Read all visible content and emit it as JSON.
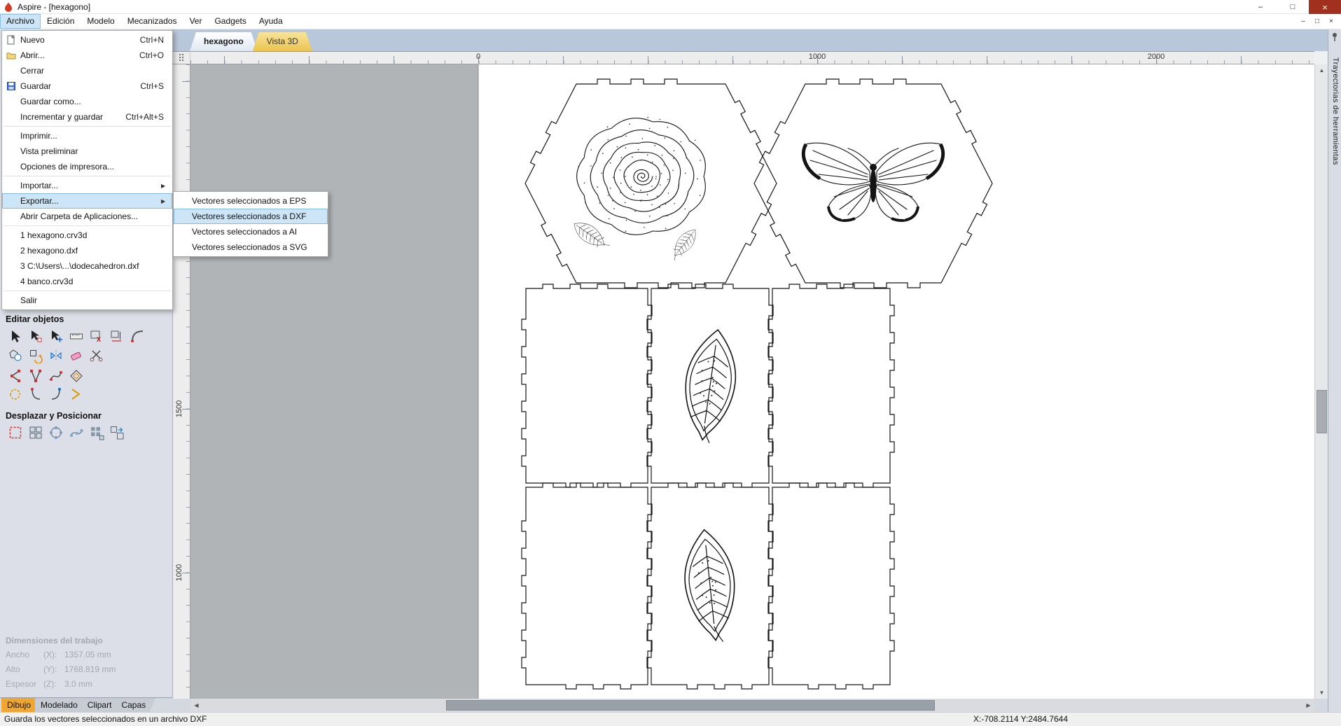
{
  "window": {
    "title": "Aspire - [hexagono]"
  },
  "icons": {
    "minimize": "–",
    "maximize": "□",
    "close": "×",
    "child_minimize": "–",
    "child_restore": "□",
    "child_close": "×",
    "submenu_arrow": "▶",
    "scroll_up": "▲",
    "scroll_down": "▼",
    "scroll_left": "◀",
    "scroll_right": "▶"
  },
  "menubar": {
    "items": [
      "Archivo",
      "Edición",
      "Modelo",
      "Mecanizados",
      "Ver",
      "Gadgets",
      "Ayuda"
    ],
    "active": "Archivo"
  },
  "file_menu": {
    "items": [
      {
        "label": "Nuevo",
        "shortcut": "Ctrl+N"
      },
      {
        "label": "Abrir...",
        "shortcut": "Ctrl+O"
      },
      {
        "label": "Cerrar",
        "shortcut": ""
      },
      {
        "label": "Guardar",
        "shortcut": "Ctrl+S"
      },
      {
        "label": "Guardar como...",
        "shortcut": ""
      },
      {
        "label": "Incrementar y guardar",
        "shortcut": "Ctrl+Alt+S"
      },
      {
        "label": "Imprimir...",
        "shortcut": ""
      },
      {
        "label": "Vista preliminar",
        "shortcut": ""
      },
      {
        "label": "Opciones de impresora...",
        "shortcut": ""
      },
      {
        "label": "Importar...",
        "shortcut": ""
      },
      {
        "label": "Exportar...",
        "shortcut": ""
      },
      {
        "label": "Abrir Carpeta de Aplicaciones...",
        "shortcut": ""
      },
      {
        "label": "1 hexagono.crv3d",
        "shortcut": ""
      },
      {
        "label": "2 hexagono.dxf",
        "shortcut": ""
      },
      {
        "label": "3 C:\\Users\\...\\dodecahedron.dxf",
        "shortcut": ""
      },
      {
        "label": "4 banco.crv3d",
        "shortcut": ""
      },
      {
        "label": "Salir",
        "shortcut": ""
      }
    ]
  },
  "export_submenu": {
    "items": [
      "Vectores seleccionados a EPS",
      "Vectores seleccionados a DXF",
      "Vectores seleccionados a AI",
      "Vectores seleccionados a SVG"
    ],
    "highlighted": "Vectores seleccionados a DXF"
  },
  "view_tabs": {
    "tab1": "hexagono",
    "tab2": "Vista 3D"
  },
  "rulers": {
    "h_labels": [
      "0",
      "1000",
      "2000"
    ],
    "v_labels": [
      "1500",
      "1000"
    ]
  },
  "left_panel": {
    "edit_section_title": "Editar objetos",
    "move_section_title": "Desplazar y Posicionar",
    "edit_tool_rows": [
      [
        "select-tool",
        "node-edit-tool",
        "move-tool",
        "measure-tool",
        "dim-x-tool",
        "dim-xy-tool",
        "fillet-tool"
      ],
      [
        "shapes-tool",
        "group-tool",
        "mirror-tool",
        "erase-tool",
        "scissors-tool"
      ],
      [
        "arc-tool",
        "polyline-tool",
        "curve-tool",
        "offset-tool"
      ],
      [
        "lasso-tool",
        "join-open-tool",
        "join-close-tool",
        "extend-tool"
      ]
    ],
    "move_tools": [
      "align-sel-tool",
      "align-grid-tool",
      "align-circle-tool",
      "path-array-tool",
      "block-array-tool",
      "nest-tool"
    ],
    "dimensions": {
      "title": "Dimensiones del trabajo",
      "rows": [
        {
          "label": "Ancho",
          "axis": "(X):",
          "value": "1357.05 mm"
        },
        {
          "label": "Alto",
          "axis": "(Y):",
          "value": "1768.819 mm"
        },
        {
          "label": "Espesor",
          "axis": "(Z):",
          "value": "3.0 mm"
        }
      ]
    }
  },
  "bottom_tabs": {
    "items": [
      "Dibujo",
      "Modelado",
      "Clipart",
      "Capas"
    ],
    "active": "Dibujo"
  },
  "right_panel": {
    "title": "Trayectorias de herramientas"
  },
  "status_bar": {
    "message": "Guarda los vectores seleccionados en un archivo DXF",
    "coordinates": "X:-708.2114 Y:2484.7644"
  },
  "colors": {
    "menu_highlight": "#cde6f7",
    "active_bottom_tab": "#f0a732",
    "vista3d_tab": "#ecc44f",
    "canvas_gray": "#b1b4b7"
  }
}
